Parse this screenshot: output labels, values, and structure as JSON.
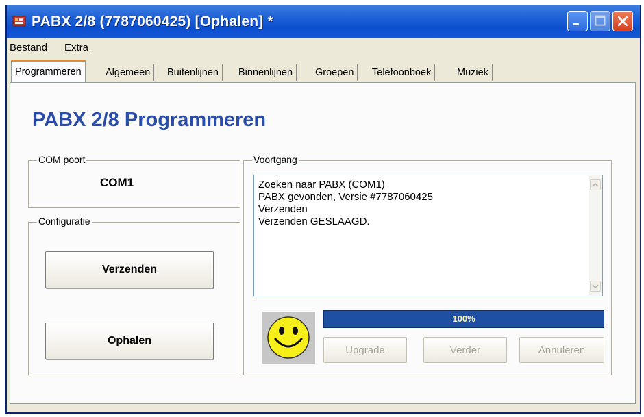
{
  "window": {
    "title": "PABX 2/8 (7787060425) [Ophalen] *"
  },
  "menu": [
    "Bestand",
    "Extra"
  ],
  "tabs": [
    {
      "label": "Programmeren",
      "active": true
    },
    {
      "label": "Algemeen"
    },
    {
      "label": "Buitenlijnen"
    },
    {
      "label": "Binnenlijnen"
    },
    {
      "label": "Groepen"
    },
    {
      "label": "Telefoonboek"
    },
    {
      "label": "Muziek"
    }
  ],
  "page": {
    "heading": "PABX 2/8 Programmeren"
  },
  "com": {
    "label": "COM poort",
    "value": "COM1"
  },
  "config": {
    "label": "Configuratie",
    "send_label": "Verzenden",
    "fetch_label": "Ophalen"
  },
  "progress": {
    "label": "Voortgang",
    "log": [
      "Zoeken naar PABX (COM1)",
      "PABX gevonden, Versie #7787060425",
      "Verzenden",
      "Verzenden GESLAAGD."
    ],
    "percent_text": "100%",
    "percent": 100,
    "status_icon": "smiley-icon"
  },
  "actions": {
    "upgrade_label": "Upgrade",
    "next_label": "Verder",
    "cancel_label": "Annuleren"
  },
  "colors": {
    "titlebar": "#0b4fcf",
    "heading": "#2a4ea8",
    "progress_fill": "#1e4fa0",
    "active_tab_accent": "#e68b2c"
  }
}
